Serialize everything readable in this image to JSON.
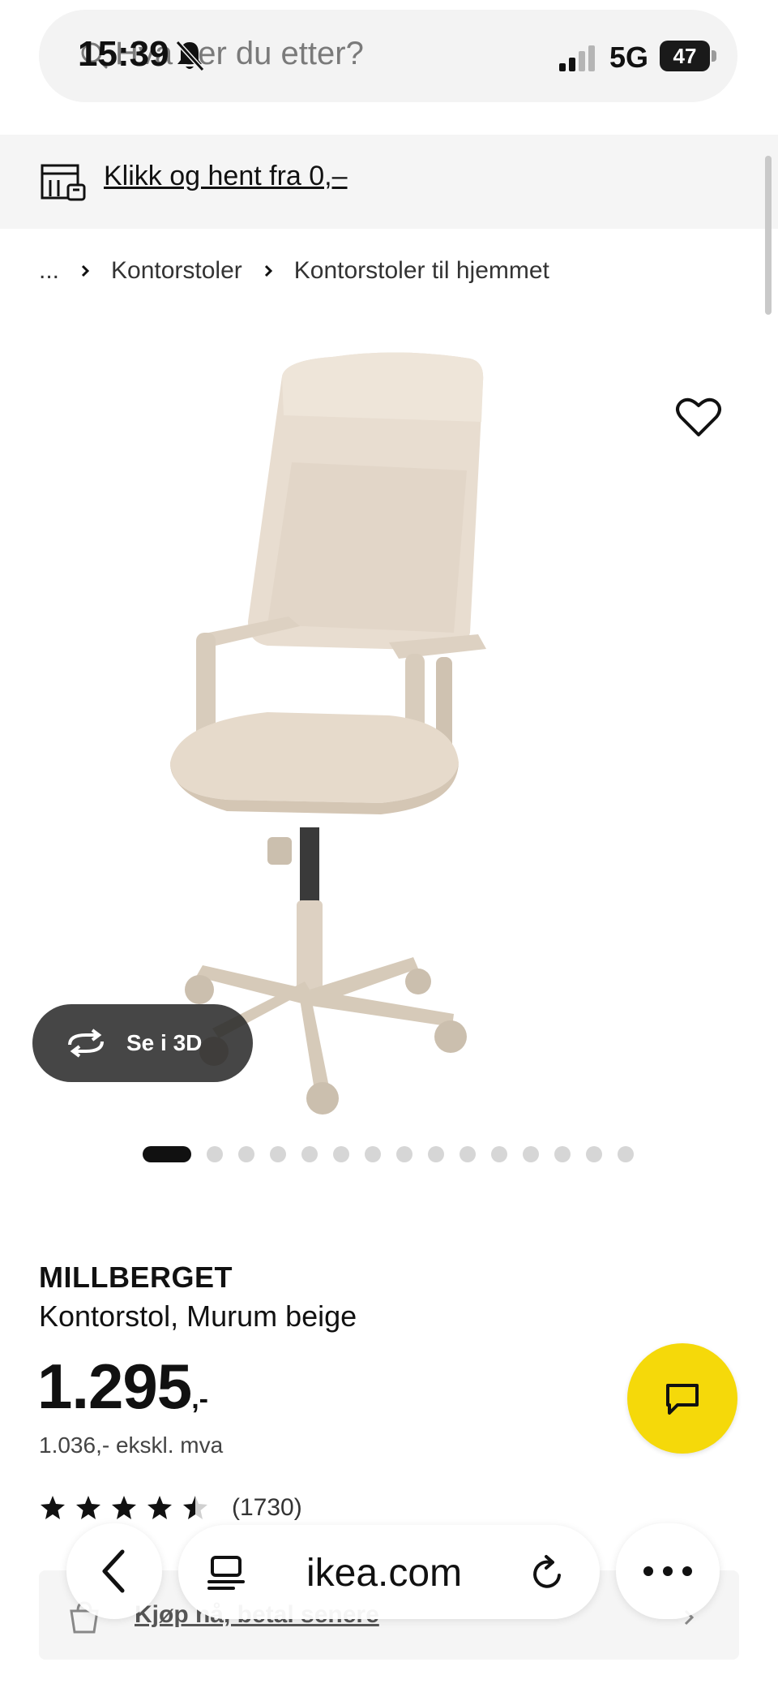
{
  "status_bar": {
    "time": "15:39",
    "network": "5G",
    "battery": "47"
  },
  "search": {
    "placeholder": "Hva ser du etter?"
  },
  "collect": {
    "label": "Klikk og hent fra 0,–"
  },
  "breadcrumb": {
    "ellipsis": "...",
    "items": [
      "Kontorstoler",
      "Kontorstoler til hjemmet"
    ]
  },
  "view3d": {
    "label": "Se i 3D"
  },
  "carousel": {
    "total": 16,
    "active_index": 0
  },
  "product": {
    "name": "MILLBERGET",
    "description": "Kontorstol, Murum beige",
    "price": "1.295",
    "price_suffix": ",-",
    "price_ex_vat": "1.036,- ekskl. mva",
    "rating": 4.5,
    "review_count": "(1730)"
  },
  "bnpl": {
    "label": "Kjøp nå, betal senere"
  },
  "browser": {
    "url": "ikea.com"
  },
  "colors": {
    "accent_yellow": "#f5d90a",
    "text": "#111111",
    "chair": "#e8ddd0"
  }
}
